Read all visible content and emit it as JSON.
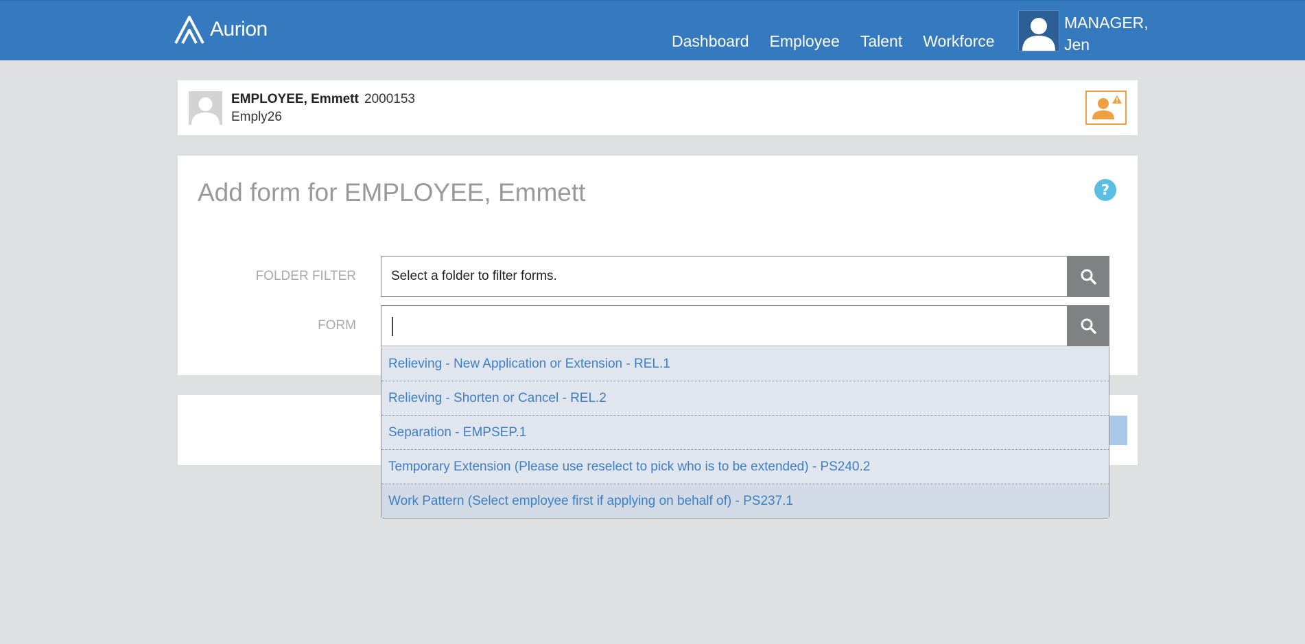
{
  "header": {
    "brand": "Aurion",
    "nav": [
      "Dashboard",
      "Employee",
      "Talent",
      "Workforce"
    ],
    "user_name_line1": "MANAGER,",
    "user_name_line2": "Jen",
    "bg_color": "#3579be"
  },
  "employee": {
    "name": "EMPLOYEE, Emmett",
    "number": "2000153",
    "code": "Emply26",
    "alert_icon": "person-warning-icon"
  },
  "form": {
    "title": "Add form for EMPLOYEE, Emmett",
    "folder_filter_label": "FOLDER FILTER",
    "folder_filter_value": "Select a folder to filter forms.",
    "form_label": "FORM",
    "form_value": "",
    "suggestions": [
      "Relieving - New Application or Extension - REL.1",
      "Relieving - Shorten or Cancel - REL.2",
      "Separation - EMPSEP.1",
      "Temporary Extension (Please use reselect to pick who is to be extended) - PS240.2",
      "Work Pattern (Select employee first if applying on behalf of) - PS237.1"
    ]
  }
}
